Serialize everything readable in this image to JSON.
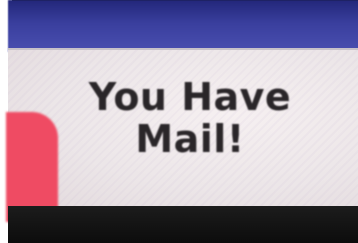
{
  "dialog": {
    "message_line1": "You Have",
    "message_line2": "Mail!"
  },
  "colors": {
    "title_bar": "#3a3f9e",
    "dialog_background": "#ece6e8",
    "message_text": "#2a2629",
    "accent_red": "#ef4b63",
    "bottom": "#111111"
  }
}
